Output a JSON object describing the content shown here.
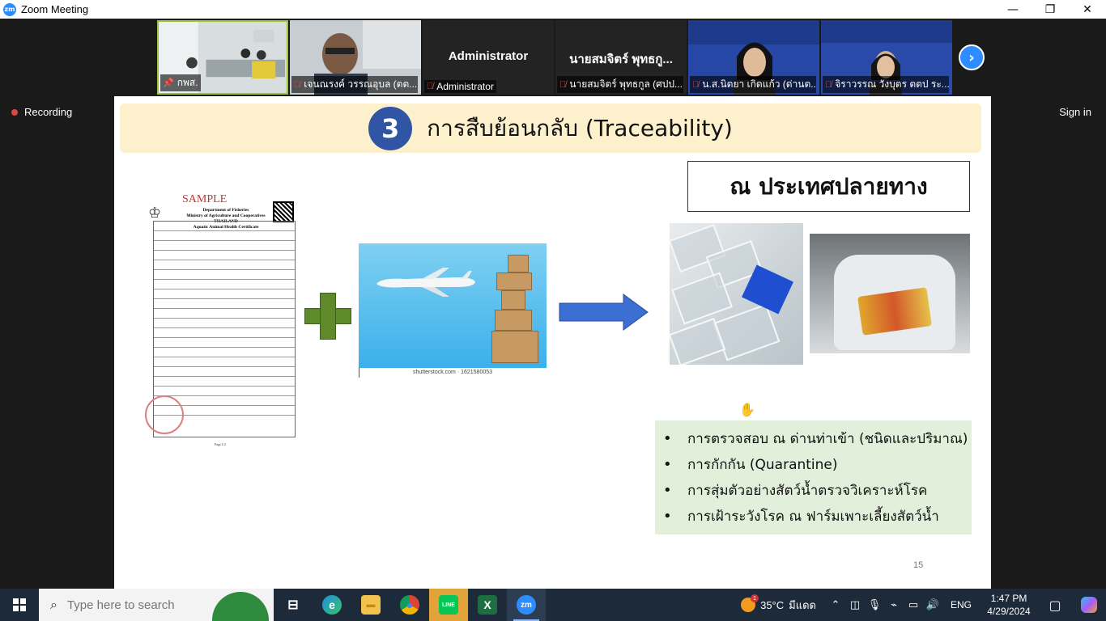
{
  "window": {
    "app_icon": "zm",
    "title": "Zoom Meeting",
    "controls": [
      "—",
      "❐",
      "✕"
    ]
  },
  "meeting": {
    "participants": [
      {
        "name": "กพส.",
        "type": "video",
        "pinned": true,
        "active": true
      },
      {
        "name": "เจนณรงค์ วรรณอุบล (ตต...",
        "type": "video",
        "muted": true
      },
      {
        "name": "Administrator",
        "display": "Administrator",
        "type": "name",
        "muted": true
      },
      {
        "name": "นายสมจิตร์ พุทธกูล (ศปป...",
        "display": "นายสมจิตร์ พุทธกู...",
        "type": "name",
        "muted": true
      },
      {
        "name": "น.ส.นิตยา เกิดแก้ว (ด่านต...",
        "type": "video",
        "muted": true
      },
      {
        "name": "จิราวรรณ วังบุตร ตตป ระ...",
        "type": "video",
        "muted": true
      }
    ],
    "recording_label": "Recording",
    "signin_label": "Sign in"
  },
  "slide": {
    "number": "3",
    "title": "การสืบย้อนกลับ (Traceability)",
    "destination_label": "ณ ประเทศปลายทาง",
    "certificate": {
      "sample_label": "SAMPLE",
      "heading": [
        "Department of Fisheries",
        "Ministry of Agriculture and Cooperatives",
        "THAILAND",
        "Aquatic Animal Health Certificate"
      ],
      "page_label": "Page 1/2"
    },
    "image_caption": "shutterstock.com · 1621580053",
    "bullets": [
      "การตรวจสอบ ณ ด่านท่าเข้า (ชนิดและปริมาณ)",
      "การกักกัน (Quarantine)",
      "การสุ่มตัวอย่างสัตว์น้ำตรวจวิเคราะห์โรค",
      "การเฝ้าระวังโรค ณ ฟาร์มเพาะเลี้ยงสัตว์น้ำ"
    ],
    "page_number": "15",
    "colors": {
      "header_bg": "#fdf0cc",
      "badge": "#2f55a4",
      "plus": "#5e8a2c",
      "arrow": "#3b6fd1",
      "bullet_bg": "#e2efda"
    }
  },
  "taskbar": {
    "search_placeholder": "Type here to search",
    "apps": [
      {
        "name": "task-view",
        "label": "⊟"
      },
      {
        "name": "edge",
        "label": "e"
      },
      {
        "name": "file-explorer",
        "label": "▬"
      },
      {
        "name": "chrome",
        "label": "●"
      },
      {
        "name": "line",
        "label": "LINE"
      },
      {
        "name": "excel",
        "label": "X"
      },
      {
        "name": "zoom",
        "label": "zm"
      }
    ],
    "weather": {
      "badge": "1",
      "temp": "35°C",
      "condition": "มีแดด"
    },
    "language": "ENG",
    "time": "1:47 PM",
    "date": "4/29/2024"
  }
}
